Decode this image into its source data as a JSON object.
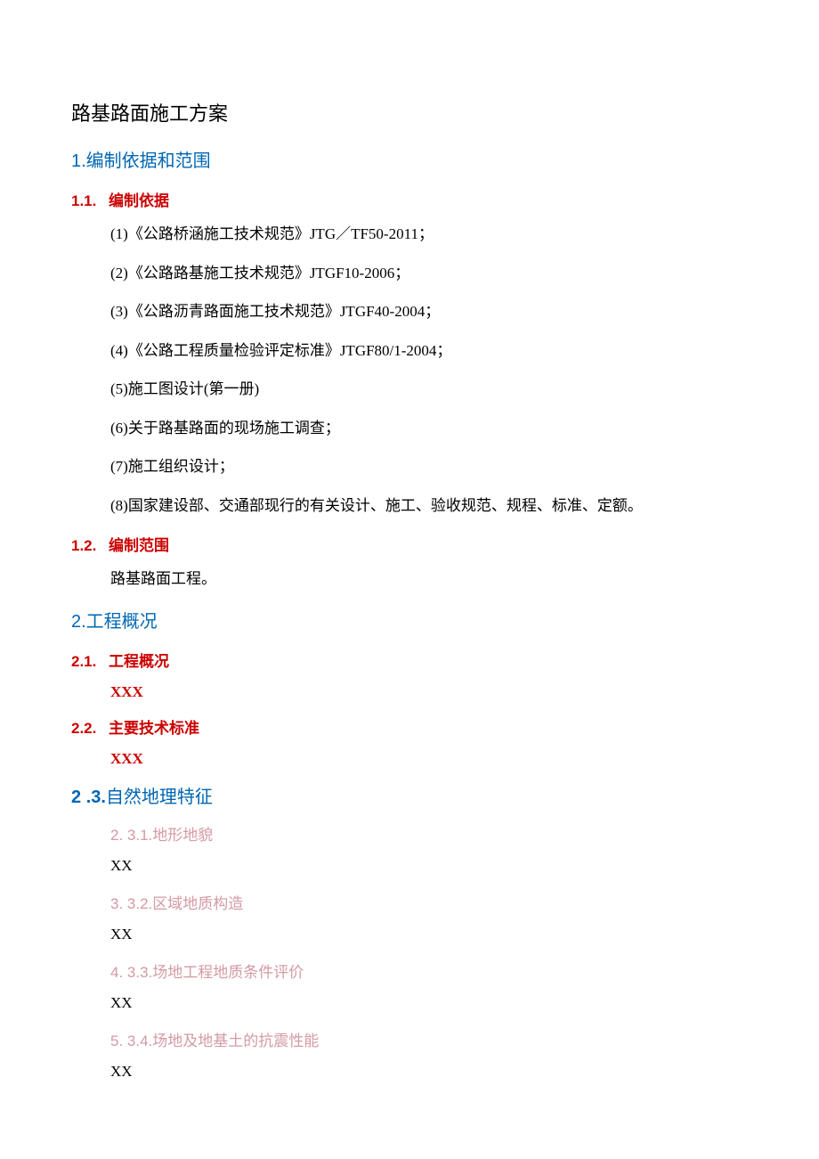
{
  "title": "路基路面施工方案",
  "s1": {
    "heading": "1.编制依据和范围",
    "s11": {
      "num": "1.1.",
      "label": "编制依据",
      "items": [
        "(1)《公路桥涵施工技术规范》JTG／TF50-2011；",
        "(2)《公路路基施工技术规范》JTGF10-2006；",
        "(3)《公路沥青路面施工技术规范》JTGF40-2004；",
        "(4)《公路工程质量检验评定标准》JTGF80/1-2004；",
        "(5)施工图设计(第一册)",
        "(6)关于路基路面的现场施工调查；",
        "(7)施工组织设计；",
        "(8)国家建设部、交通部现行的有关设计、施工、验收规范、规程、标准、定额。"
      ]
    },
    "s12": {
      "num": "1.2.",
      "label": "编制范围",
      "body": "路基路面工程。"
    }
  },
  "s2": {
    "heading": "2.工程概况",
    "s21": {
      "num": "2.1.",
      "label": "工程概况",
      "body": "XXX"
    },
    "s22": {
      "num": "2.2.",
      "label": "主要技术标准",
      "body": "XXX"
    },
    "s23": {
      "num_left": "2",
      "num_right": ".3.",
      "label": "自然地理特征",
      "items": [
        {
          "listnum": "2.",
          "code": "3.1.",
          "label": "地形地貌",
          "body": "XX"
        },
        {
          "listnum": "3.",
          "code": "3.2.",
          "label": "区域地质构造",
          "body": "XX"
        },
        {
          "listnum": "4.",
          "code": "3.3.",
          "label": "场地工程地质条件评价",
          "body": "XX"
        },
        {
          "listnum": "5.",
          "code": "3.4.",
          "label": "场地及地基土的抗震性能",
          "body": "XX"
        }
      ]
    }
  }
}
